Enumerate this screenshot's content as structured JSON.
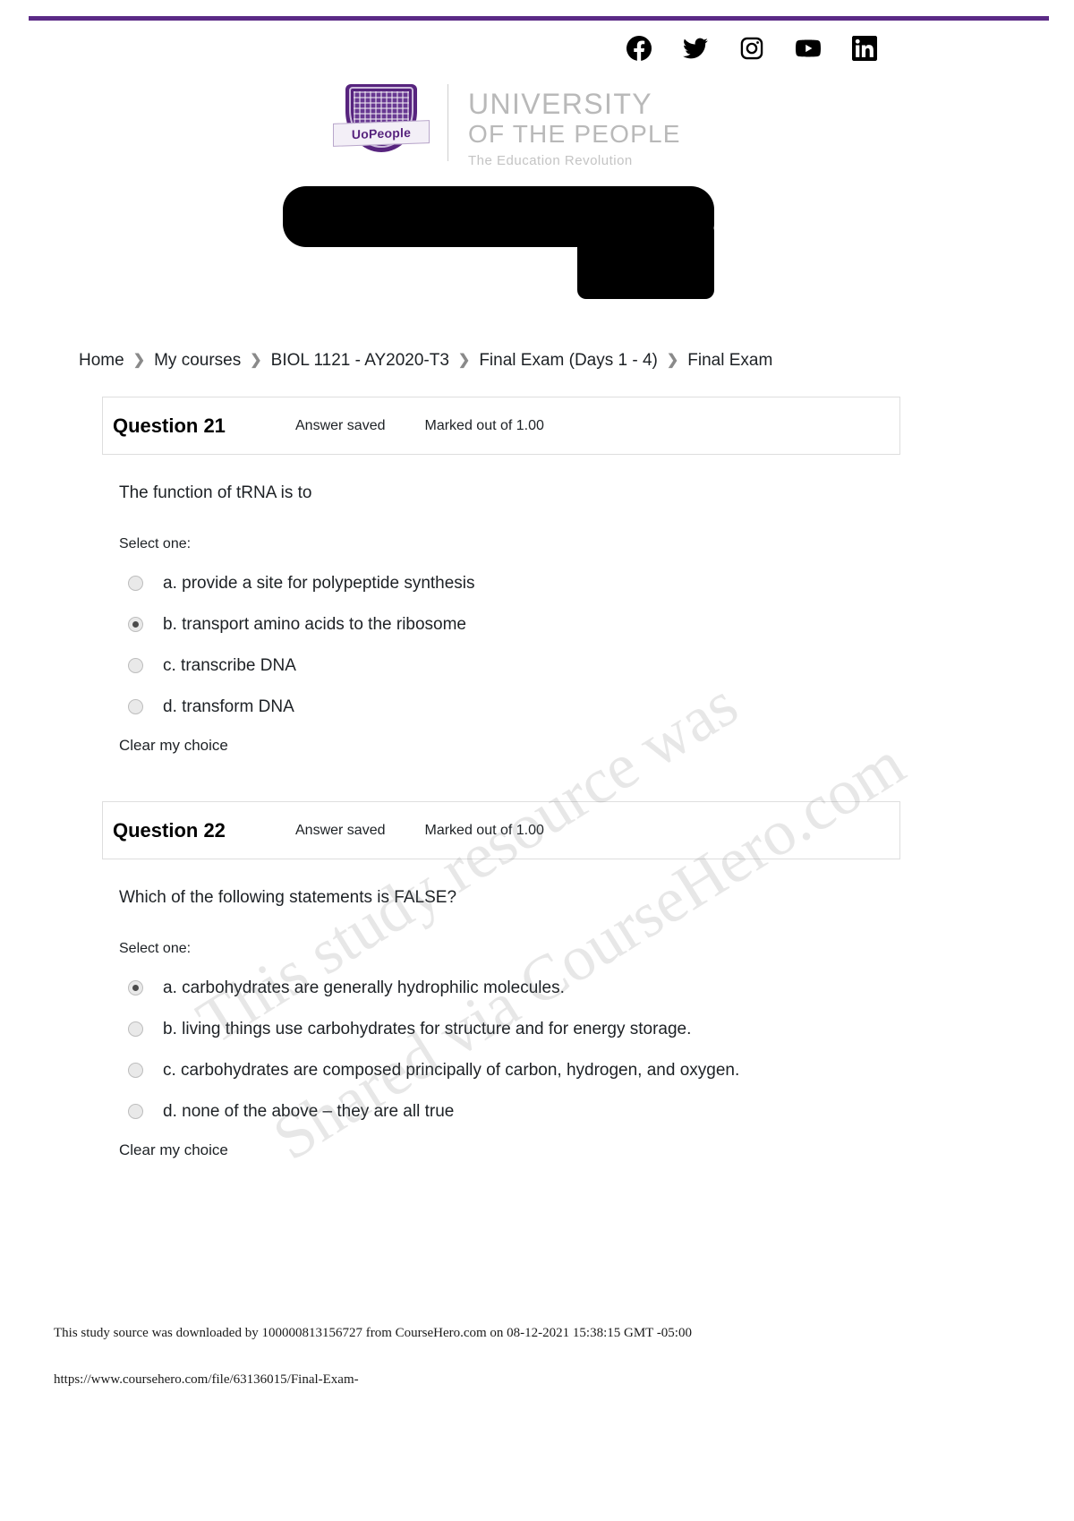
{
  "header": {
    "accent_color": "#5b2a86",
    "social": [
      {
        "name": "facebook-icon",
        "label": "Facebook"
      },
      {
        "name": "twitter-icon",
        "label": "Twitter"
      },
      {
        "name": "instagram-icon",
        "label": "Instagram"
      },
      {
        "name": "youtube-icon",
        "label": "YouTube"
      },
      {
        "name": "linkedin-icon",
        "label": "LinkedIn"
      }
    ],
    "logo": {
      "shield_text": "UoPeople",
      "line1": "UNIVERSITY",
      "line2": "OF THE PEOPLE",
      "tagline": "The Education Revolution"
    }
  },
  "breadcrumb": {
    "separator": "❯",
    "items": [
      "Home",
      "My courses",
      "BIOL 1121 - AY2020-T3",
      "Final Exam (Days 1 - 4)",
      "Final Exam"
    ]
  },
  "questions": [
    {
      "title": "Question 21",
      "state": "Answer saved",
      "marks": "Marked out of 1.00",
      "text": "The function of tRNA is to",
      "select_label": "Select one:",
      "clear_label": "Clear my choice",
      "options": [
        {
          "label": "a. provide a site for polypeptide synthesis",
          "checked": false
        },
        {
          "label": "b. transport amino acids to the ribosome",
          "checked": true
        },
        {
          "label": "c. transcribe DNA",
          "checked": false
        },
        {
          "label": "d. transform DNA",
          "checked": false
        }
      ]
    },
    {
      "title": "Question 22",
      "state": "Answer saved",
      "marks": "Marked out of 1.00",
      "text": "Which of the following statements is FALSE?",
      "select_label": "Select one:",
      "clear_label": "Clear my choice",
      "options": [
        {
          "label": "a. carbohydrates are generally hydrophilic molecules.",
          "checked": true
        },
        {
          "label": "b. living things use carbohydrates for structure and for energy storage.",
          "checked": false
        },
        {
          "label": "c. carbohydrates are composed principally of carbon, hydrogen, and oxygen.",
          "checked": false
        },
        {
          "label": "d. none of the above – they are all true",
          "checked": false
        }
      ]
    }
  ],
  "watermark": {
    "line1": "This study resource was",
    "line2": "Shared via CourseHero.com"
  },
  "footer": {
    "note": "This study source was downloaded by 100000813156727 from CourseHero.com on 08-12-2021 15:38:15 GMT -05:00",
    "url": "https://www.coursehero.com/file/63136015/Final-Exam-"
  }
}
